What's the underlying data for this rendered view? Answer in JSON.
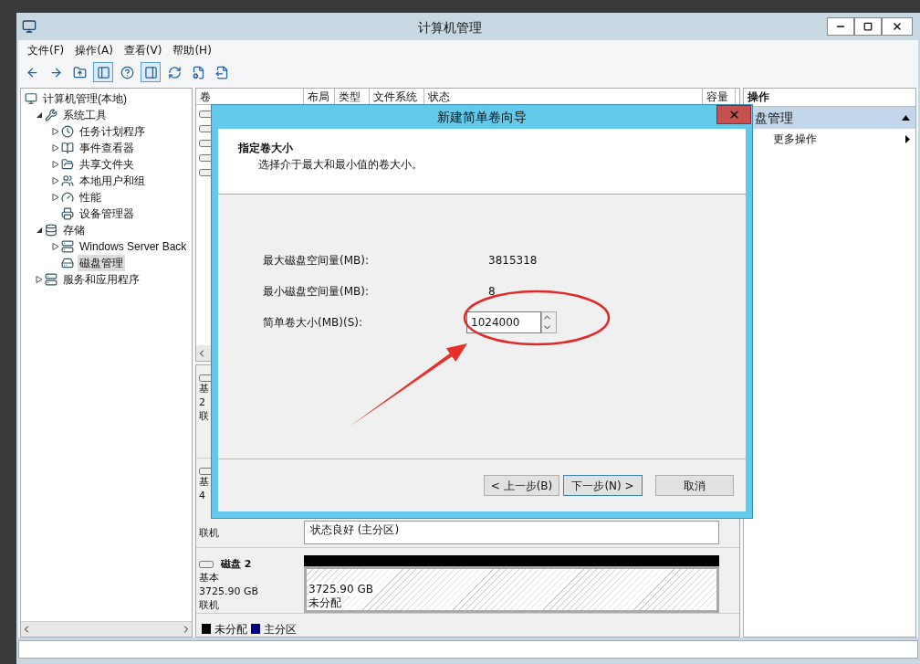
{
  "window": {
    "title": "计算机管理"
  },
  "menu": [
    "文件(F)",
    "操作(A)",
    "查看(V)",
    "帮助(H)"
  ],
  "toolbar": [
    {
      "pressed": false
    },
    {
      "pressed": false
    },
    {
      "pressed": false
    },
    {
      "pressed": true
    },
    {
      "pressed": false
    },
    {
      "pressed": true
    },
    {
      "pressed": false
    },
    {
      "pressed": false
    },
    {
      "pressed": false
    }
  ],
  "tree": [
    {
      "label": "计算机管理(本地)",
      "selected": false,
      "children": [
        {
          "label": "系统工具",
          "expanded": true,
          "selected": false,
          "children": [
            {
              "label": "任务计划程序",
              "expanded": false,
              "selected": false
            },
            {
              "label": "事件查看器",
              "expanded": false,
              "selected": false
            },
            {
              "label": "共享文件夹",
              "expanded": false,
              "selected": false
            },
            {
              "label": "本地用户和组",
              "expanded": false,
              "selected": false
            },
            {
              "label": "性能",
              "expanded": false,
              "selected": false
            },
            {
              "label": "设备管理器",
              "selected": false
            }
          ]
        },
        {
          "label": "存储",
          "expanded": true,
          "selected": false,
          "children": [
            {
              "label": "Windows Server Back",
              "expanded": false,
              "selected": false
            },
            {
              "label": "磁盘管理",
              "selected": true
            }
          ]
        },
        {
          "label": "服务和应用程序",
          "expanded": false,
          "selected": false
        }
      ]
    }
  ],
  "volumes": {
    "columns": [
      "卷",
      "布局",
      "类型",
      "文件系统",
      "状态",
      "容量"
    ]
  },
  "disks": [
    {
      "lines": [
        "基",
        "2",
        "联"
      ]
    },
    {
      "lines": [
        "基",
        "4",
        "联机"
      ],
      "partitions": [
        {
          "status": "状态良好 (主分区)",
          "kind": "primary"
        }
      ]
    },
    {
      "name": "磁盘 2",
      "lines": [
        "基本",
        "3725.90 GB",
        "联机"
      ],
      "partitions": [
        {
          "size": "3725.90 GB",
          "status": "未分配",
          "kind": "unallocated"
        }
      ]
    }
  ],
  "legend": [
    {
      "label": "未分配",
      "color": "#000000"
    },
    {
      "label": "主分区",
      "color": "#000080"
    }
  ],
  "actions": {
    "title": "操作",
    "section": {
      "title": "盘管理",
      "expanded": true
    },
    "items": [
      {
        "label": "更多操作"
      }
    ]
  },
  "dialog": {
    "title": "新建简单卷向导",
    "heading": "指定卷大小",
    "subheading": "选择介于最大和最小值的卷大小。",
    "fields": [
      {
        "label": "最大磁盘空间量(MB):",
        "value": "3815318",
        "kind": "text"
      },
      {
        "label": "最小磁盘空间量(MB):",
        "value": "8",
        "kind": "text"
      },
      {
        "label": "简单卷大小(MB)(S):",
        "value": "1024000",
        "kind": "spin"
      }
    ],
    "buttons": [
      {
        "label": "< 上一步(B)",
        "default": false
      },
      {
        "label": "下一步(N) >",
        "default": true
      },
      {
        "label": "取消",
        "default": false
      }
    ]
  }
}
